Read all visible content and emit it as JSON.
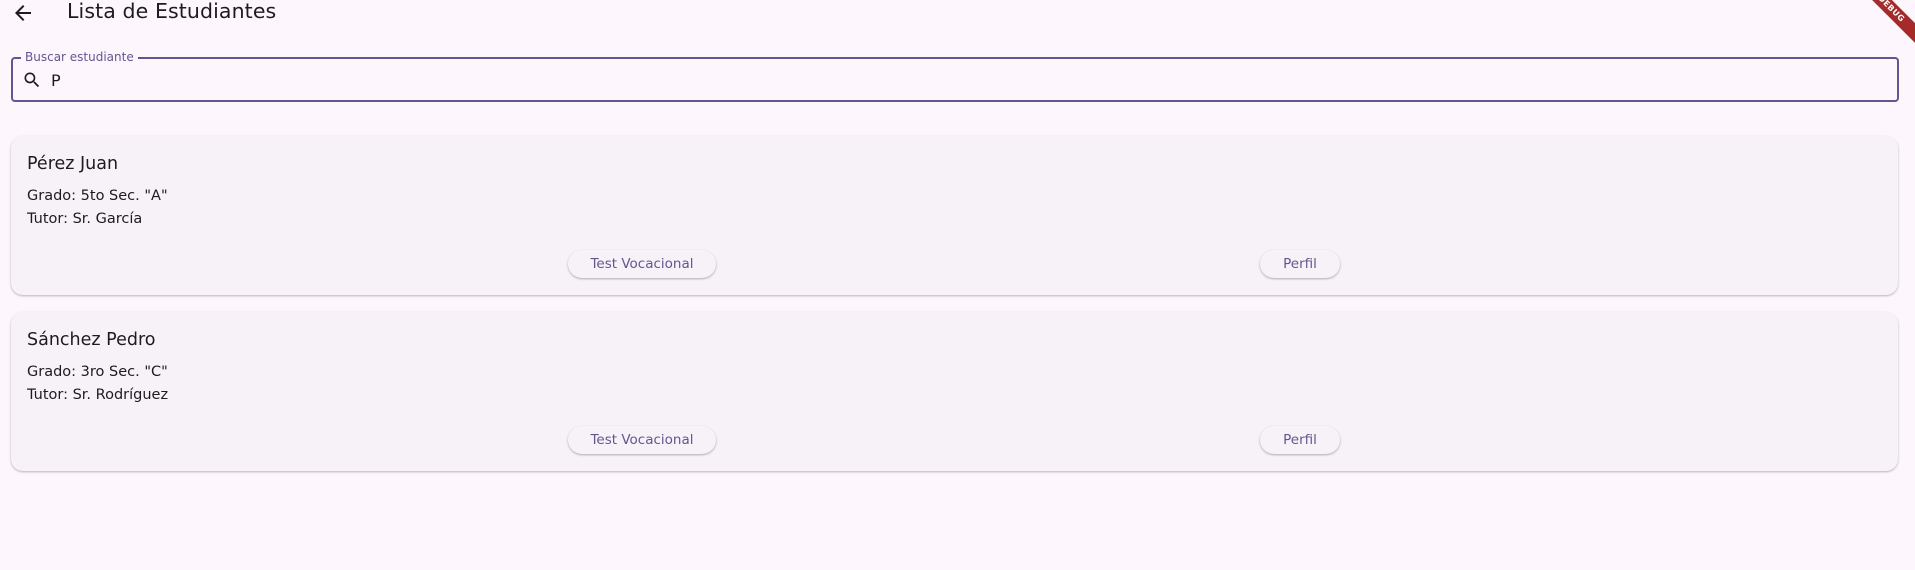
{
  "app": {
    "title": "Lista de Estudiantes",
    "debug_label": "DEBUG"
  },
  "search": {
    "label": "Buscar estudiante",
    "value": "P"
  },
  "students": [
    {
      "name": "Pérez Juan",
      "grade": "Grado: 5to Sec. \"A\"",
      "tutor": "Tutor: Sr. García",
      "test_label": "Test Vocacional",
      "profile_label": "Perfil"
    },
    {
      "name": "Sánchez Pedro",
      "grade": "Grado: 3ro Sec. \"C\"",
      "tutor": "Tutor: Sr. Rodríguez",
      "test_label": "Test Vocacional",
      "profile_label": "Perfil"
    }
  ],
  "colors": {
    "background": "#fdf7fd",
    "primary": "#65558f",
    "card": "#f7f2f8",
    "text": "#1d1b20"
  }
}
